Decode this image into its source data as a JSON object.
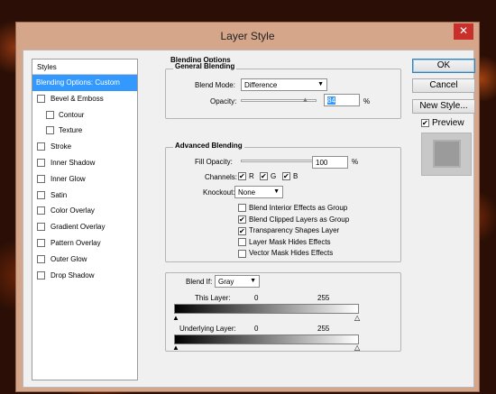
{
  "window": {
    "title": "Layer Style",
    "close_symbol": "✕"
  },
  "styles_panel": {
    "header": "Styles",
    "items": [
      {
        "label": "Blending Options: Custom",
        "selected": true,
        "checkbox": false,
        "checked": false,
        "sub": false
      },
      {
        "label": "Bevel & Emboss",
        "selected": false,
        "checkbox": true,
        "checked": false,
        "sub": false
      },
      {
        "label": "Contour",
        "selected": false,
        "checkbox": true,
        "checked": false,
        "sub": true
      },
      {
        "label": "Texture",
        "selected": false,
        "checkbox": true,
        "checked": false,
        "sub": true
      },
      {
        "label": "Stroke",
        "selected": false,
        "checkbox": true,
        "checked": false,
        "sub": false
      },
      {
        "label": "Inner Shadow",
        "selected": false,
        "checkbox": true,
        "checked": false,
        "sub": false
      },
      {
        "label": "Inner Glow",
        "selected": false,
        "checkbox": true,
        "checked": false,
        "sub": false
      },
      {
        "label": "Satin",
        "selected": false,
        "checkbox": true,
        "checked": false,
        "sub": false
      },
      {
        "label": "Color Overlay",
        "selected": false,
        "checkbox": true,
        "checked": false,
        "sub": false
      },
      {
        "label": "Gradient Overlay",
        "selected": false,
        "checkbox": true,
        "checked": false,
        "sub": false
      },
      {
        "label": "Pattern Overlay",
        "selected": false,
        "checkbox": true,
        "checked": false,
        "sub": false
      },
      {
        "label": "Outer Glow",
        "selected": false,
        "checkbox": true,
        "checked": false,
        "sub": false
      },
      {
        "label": "Drop Shadow",
        "selected": false,
        "checkbox": true,
        "checked": false,
        "sub": false
      }
    ]
  },
  "blending_options": {
    "title": "Blending Options",
    "general": {
      "title": "General Blending",
      "blend_mode_label": "Blend Mode:",
      "blend_mode_value": "Difference",
      "opacity_label": "Opacity:",
      "opacity_value": "84",
      "opacity_level": 0.84,
      "percent": "%"
    },
    "advanced": {
      "title": "Advanced Blending",
      "fill_opacity_label": "Fill Opacity:",
      "fill_opacity_value": "100",
      "fill_opacity_level": 1.0,
      "percent": "%",
      "channels_label": "Channels:",
      "channels": [
        {
          "label": "R",
          "checked": true
        },
        {
          "label": "G",
          "checked": true
        },
        {
          "label": "B",
          "checked": true
        }
      ],
      "knockout_label": "Knockout:",
      "knockout_value": "None",
      "options": [
        {
          "label": "Blend Interior Effects as Group",
          "checked": false
        },
        {
          "label": "Blend Clipped Layers as Group",
          "checked": true
        },
        {
          "label": "Transparency Shapes Layer",
          "checked": true
        },
        {
          "label": "Layer Mask Hides Effects",
          "checked": false
        },
        {
          "label": "Vector Mask Hides Effects",
          "checked": false
        }
      ]
    },
    "blend_if": {
      "label": "Blend If:",
      "value": "Gray",
      "this_layer": {
        "label": "This Layer:",
        "min": "0",
        "max": "255"
      },
      "underlying_layer": {
        "label": "Underlying Layer:",
        "min": "0",
        "max": "255"
      }
    }
  },
  "buttons": {
    "ok": "OK",
    "reset": "Cancel",
    "new_style": "New Style...",
    "preview_label": "Preview",
    "preview_checked": true
  },
  "colors": {
    "accent": "#3399ff",
    "frame": "#d5a68a",
    "close": "#c9302c"
  }
}
